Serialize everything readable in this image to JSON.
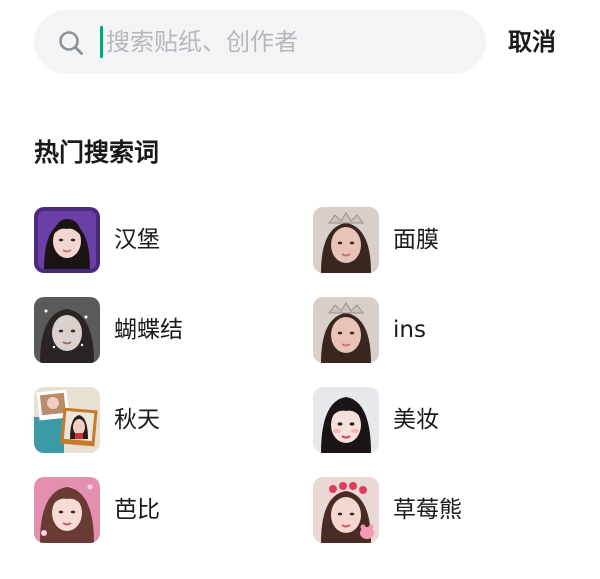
{
  "search": {
    "placeholder": "搜索贴纸、创作者",
    "icon": "search-icon",
    "cancel_label": "取消",
    "accent_color": "#00a680"
  },
  "hot": {
    "title": "热门搜索词",
    "items": [
      {
        "label": "汉堡",
        "thumb": "face-thumbnail-purple-frame"
      },
      {
        "label": "面膜",
        "thumb": "face-thumbnail-crown"
      },
      {
        "label": "蝴蝶结",
        "thumb": "face-thumbnail-sparkle"
      },
      {
        "label": "ins",
        "thumb": "face-thumbnail-crown"
      },
      {
        "label": "秋天",
        "thumb": "photo-collage-thumbnail"
      },
      {
        "label": "美妆",
        "thumb": "face-thumbnail-makeup"
      },
      {
        "label": "芭比",
        "thumb": "face-thumbnail-pink"
      },
      {
        "label": "草莓熊",
        "thumb": "face-thumbnail-strawberry"
      }
    ]
  }
}
